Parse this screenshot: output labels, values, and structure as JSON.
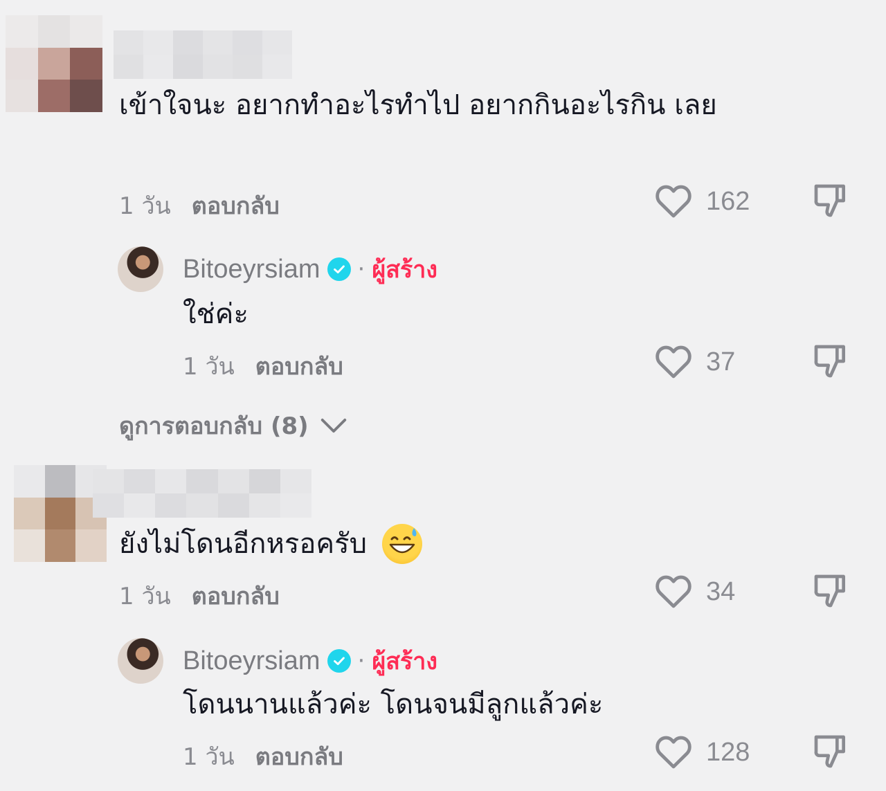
{
  "comments": [
    {
      "text": "เข้าใจนะ อยากทำอะไรทำไป อยากกินอะไรกิน เลย",
      "time": "1 วัน",
      "reply": "ตอบกลับ",
      "likes": "162",
      "reply_item": {
        "username": "Bitoeyrsiam",
        "separator": "·",
        "badge": "ผู้สร้าง",
        "text": "ใช่ค่ะ",
        "time": "1 วัน",
        "reply": "ตอบกลับ",
        "likes": "37"
      },
      "view_replies": "ดูการตอบกลับ (8)"
    },
    {
      "text": "ยังไม่โดนอีกหรอครับ",
      "emoji": "grinning-sweat-emoji",
      "time": "1 วัน",
      "reply": "ตอบกลับ",
      "likes": "34",
      "reply_item": {
        "username": "Bitoeyrsiam",
        "separator": "·",
        "badge": "ผู้สร้าง",
        "text": "โดนนานแล้วค่ะ โดนจนมีลูกแล้วค่ะ",
        "time": "1 วัน",
        "reply": "ตอบกลับ",
        "likes": "128"
      }
    }
  ],
  "colors": {
    "background": "#f1f1f2",
    "creator": "#fe2c55",
    "verified": "#20d5ec",
    "meta": "#8a8b91"
  }
}
